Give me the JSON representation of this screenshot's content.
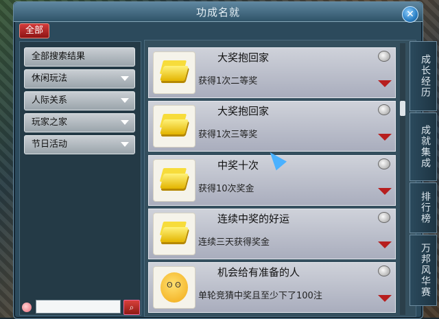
{
  "window": {
    "title": "功成名就",
    "close_icon": "close-icon"
  },
  "filter": {
    "all_label": "全部"
  },
  "categories": [
    {
      "label": "全部搜索结果",
      "has_arrow": false
    },
    {
      "label": "休闲玩法",
      "has_arrow": true
    },
    {
      "label": "人际关系",
      "has_arrow": true
    },
    {
      "label": "玩家之家",
      "has_arrow": true
    },
    {
      "label": "节日活动",
      "has_arrow": true
    }
  ],
  "search": {
    "placeholder": "",
    "button_icon": "search-icon"
  },
  "achievements": [
    {
      "title": "大奖抱回家",
      "desc": "获得1次二等奖",
      "icon": "gold-bars-icon"
    },
    {
      "title": "大奖抱回家",
      "desc": "获得1次三等奖",
      "icon": "gold-bars-icon"
    },
    {
      "title": "中奖十次",
      "desc": "获得10次奖金",
      "icon": "gold-bars-icon"
    },
    {
      "title": "连续中奖的好运",
      "desc": "连续三天获得奖金",
      "icon": "gold-bars-icon"
    },
    {
      "title": "机会给有准备的人",
      "desc": "单轮竞猜中奖且至少下了100注",
      "icon": "smiley-face-icon"
    }
  ],
  "side_tabs": [
    "成长经历",
    "成就集成",
    "排行榜",
    "万邦风华赛"
  ]
}
